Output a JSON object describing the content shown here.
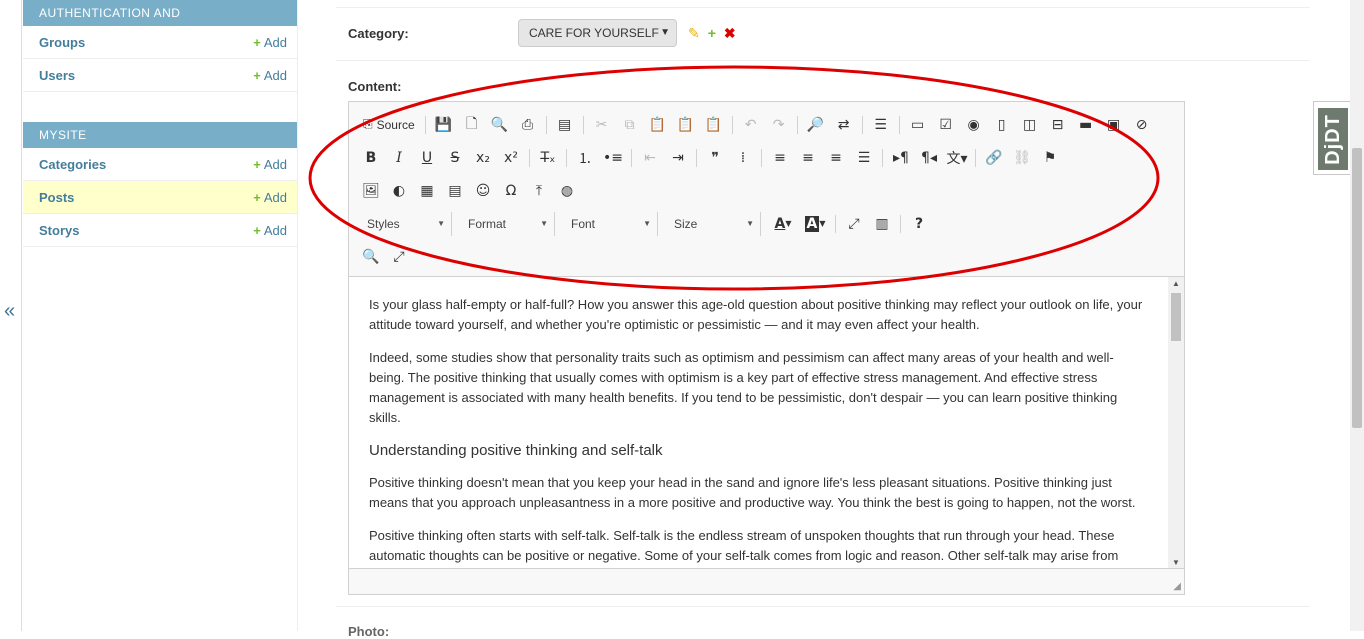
{
  "sidebar": {
    "collapse_icon": "«",
    "sections": [
      {
        "caption": "AUTHENTICATION AND AUTHORIZATION",
        "items": [
          {
            "label": "Groups",
            "add": "Add"
          },
          {
            "label": "Users",
            "add": "Add"
          }
        ]
      },
      {
        "caption": "MYSITE",
        "items": [
          {
            "label": "Categories",
            "add": "Add"
          },
          {
            "label": "Posts",
            "add": "Add"
          },
          {
            "label": "Storys",
            "add": "Add"
          }
        ]
      }
    ],
    "active_item": "Posts"
  },
  "form": {
    "category_label": "Category:",
    "category_value": "CARE FOR YOURSELF",
    "content_label": "Content:",
    "photo_label": "Photo:"
  },
  "toolbar": {
    "source_label": "Source",
    "styles": "Styles",
    "format": "Format",
    "font": "Font",
    "size": "Size",
    "text_color": "A",
    "bg_color": "A",
    "help": "?"
  },
  "editor": {
    "p1": "Is your glass half-empty or half-full? How you answer this age-old question about positive thinking may reflect your outlook on life, your attitude toward yourself, and whether you're optimistic or pessimistic — and it may even affect your health.",
    "p2": "Indeed, some studies show that personality traits such as optimism and pessimism can affect many areas of your health and well-being. The positive thinking that usually comes with optimism is a key part of effective stress management. And effective stress management is associated with many health benefits. If you tend to be pessimistic, don't despair — you can learn positive thinking skills.",
    "h1": "Understanding positive thinking and self-talk",
    "p3": "Positive thinking doesn't mean that you keep your head in the sand and ignore life's less pleasant situations. Positive thinking just means that you approach unpleasantness in a more positive and productive way. You think the best is going to happen, not the worst.",
    "p4": "Positive thinking often starts with self-talk. Self-talk is the endless stream of unspoken thoughts that run through your head. These automatic thoughts can be positive or negative. Some of your self-talk comes from logic and reason. Other self-talk may arise from"
  },
  "djdt": {
    "label": "DjDT"
  },
  "colors": {
    "caption_bg": "#79aec8",
    "link": "#447e9b",
    "active_row": "#ffffcc",
    "add_plus": "#70bf2b",
    "annotation": "#dd0000"
  }
}
